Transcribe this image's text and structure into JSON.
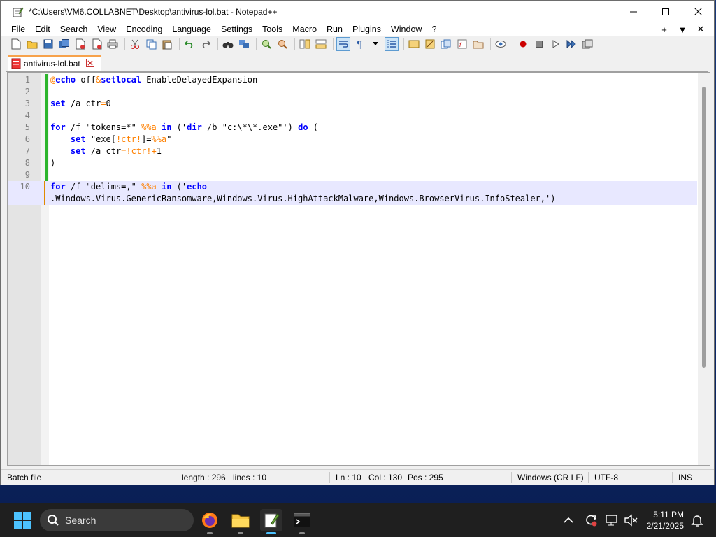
{
  "window": {
    "title": "*C:\\Users\\VM6.COLLABNET\\Desktop\\antivirus-lol.bat - Notepad++"
  },
  "menu": {
    "items": [
      "File",
      "Edit",
      "Search",
      "View",
      "Encoding",
      "Language",
      "Settings",
      "Tools",
      "Macro",
      "Run",
      "Plugins",
      "Window",
      "?"
    ],
    "right": [
      "+",
      "▼",
      "✕"
    ]
  },
  "tabs": [
    {
      "label": "antivirus-lol.bat",
      "modified": true
    }
  ],
  "editor": {
    "line_numbers": [
      "1",
      "2",
      "3",
      "4",
      "5",
      "6",
      "7",
      "8",
      "9",
      "10"
    ],
    "current_line": "10"
  },
  "status": {
    "language": "Batch file",
    "length": "length : 296",
    "lines": "lines : 10",
    "ln": "Ln : 10",
    "col": "Col : 130",
    "pos": "Pos : 295",
    "eol": "Windows (CR LF)",
    "encoding": "UTF-8",
    "mode": "INS"
  },
  "taskbar": {
    "search_placeholder": "Search",
    "time": "5:11 PM",
    "date": "2/21/2025"
  }
}
